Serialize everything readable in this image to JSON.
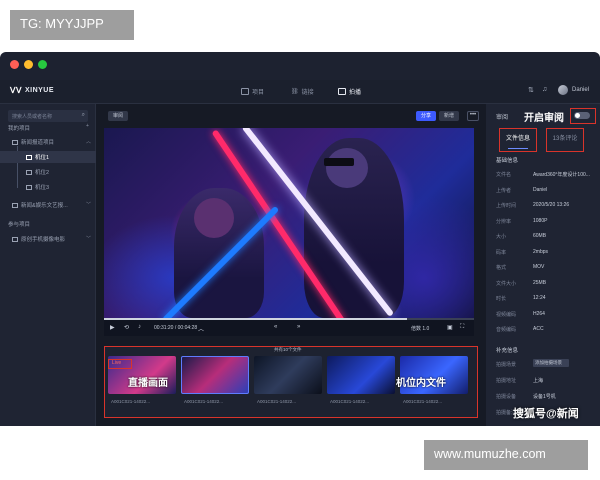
{
  "tags": {
    "top": "TG: MYYJJPP",
    "bottom": "www.mumuzhe.com"
  },
  "window": {
    "traffic_lights": [
      "#ff5f56",
      "#ffbd2e",
      "#27c93f"
    ]
  },
  "topbar": {
    "logo": "XINYUE",
    "nav": [
      {
        "label": "项目",
        "icon": "folder-icon"
      },
      {
        "label": "链接",
        "icon": "link-icon"
      },
      {
        "label": "拍播",
        "icon": "camera-icon"
      }
    ],
    "user": "Daniel"
  },
  "sidebar": {
    "search_placeholder": "搜索人员或者名称",
    "sections": [
      {
        "label": "我的项目"
      },
      {
        "label": "新闻报道项目"
      },
      {
        "label": "机位1"
      },
      {
        "label": "机位2"
      },
      {
        "label": "机位3"
      },
      {
        "label": "新闻&娱乐文艺报..."
      },
      {
        "label": "参与项目"
      },
      {
        "label": "原创手机摄像电影"
      }
    ]
  },
  "center": {
    "audit_button": "审阅",
    "share_button": "分享",
    "add_button": "新增",
    "more_button": "•••",
    "player": {
      "time": "00:31:20 / 00:04:28",
      "speed": "倍数 1.0",
      "progress": 0.82
    },
    "strip": {
      "file_count": "共有10个文件",
      "live_badge": "Live",
      "thumb_overlay_live": "直播画面",
      "thumb_overlay_files": "机位内文件",
      "thumbs": [
        {
          "label": "A001C021-14022..."
        },
        {
          "label": "A001C021-14022..."
        },
        {
          "label": "A001C021-14022..."
        },
        {
          "label": "A001C021-14022..."
        },
        {
          "label": "A001C021-14022..."
        }
      ]
    }
  },
  "right": {
    "audit_label": "审阅",
    "open_audit": "开启审阅",
    "tabs": {
      "info": "文件信息",
      "comments": "13条评论"
    },
    "basic_title": "基础信息",
    "fields": [
      {
        "label": "文件名",
        "value": "Award360°年度设计100..."
      },
      {
        "label": "上传者",
        "value": "Daniel"
      },
      {
        "label": "上传时间",
        "value": "2020/5/20 13:26"
      },
      {
        "label": "分辨率",
        "value": "1080P"
      },
      {
        "label": "大小",
        "value": "60MB"
      },
      {
        "label": "码率",
        "value": "2mbps"
      },
      {
        "label": "格式",
        "value": "MOV"
      },
      {
        "label": "文件大小",
        "value": "25MB"
      },
      {
        "label": "时长",
        "value": "12:24"
      },
      {
        "label": "视频编码",
        "value": "H264"
      },
      {
        "label": "音频编码",
        "value": "ACC"
      }
    ],
    "extra_title": "补充信息",
    "extra_fields": [
      {
        "label": "拍摄场景",
        "value": "添加拍摄场景"
      },
      {
        "label": "拍摄地址",
        "value": "上海"
      },
      {
        "label": "拍摄设备",
        "value": "设备1号机"
      },
      {
        "label": "拍摄备注",
        "value": ""
      }
    ]
  },
  "watermark": "搜狐号@新闻"
}
